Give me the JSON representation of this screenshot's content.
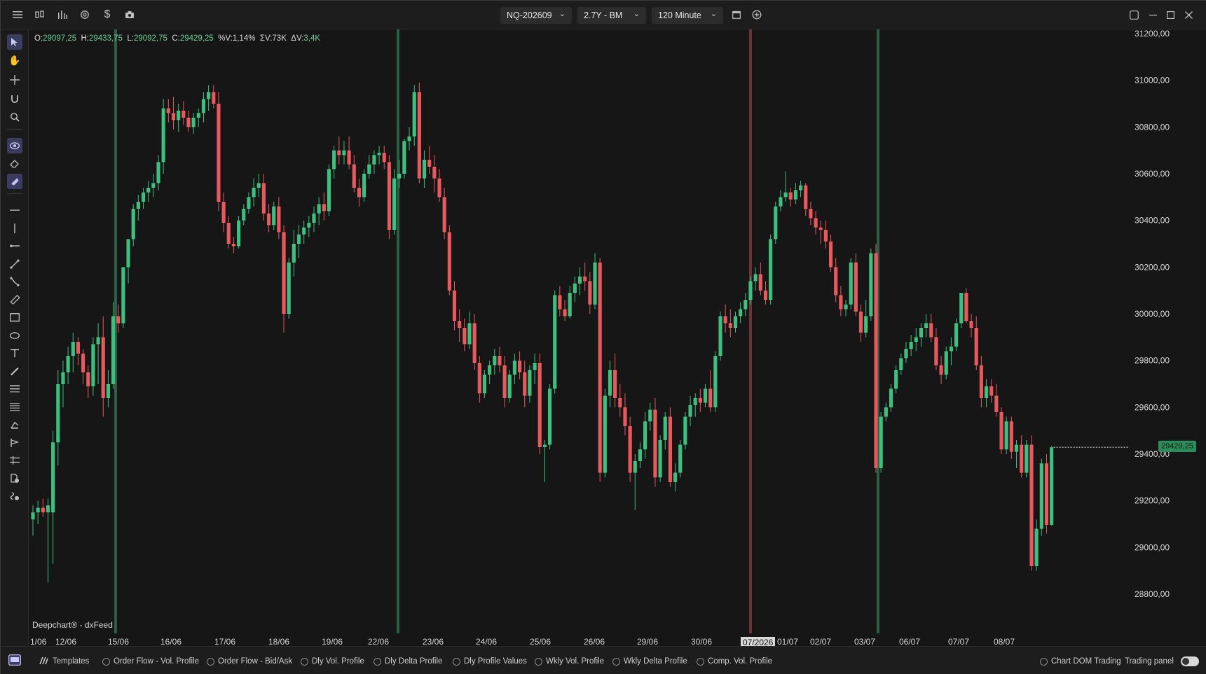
{
  "topbar": {
    "symbol": "NQ-202609",
    "range": "2.7Y - BM",
    "timeframe": "120 Minute",
    "icons": [
      "menu-icon",
      "candles-icon",
      "bars-icon",
      "settings-icon",
      "dollar-icon",
      "camera-icon",
      "calendar-icon",
      "add-icon"
    ],
    "window_icons": [
      "layout-icon",
      "minimize-icon",
      "maximize-icon",
      "close-icon"
    ]
  },
  "ohlc": {
    "o_label": "O:",
    "o": "29097,25",
    "h_label": "H:",
    "h": "29433,75",
    "l_label": "L:",
    "l": "29092,75",
    "c_label": "C:",
    "c": "29429,25",
    "pv_label": "%V:",
    "pv": "1,14%",
    "sv_label": "ΣV:",
    "sv": "73K",
    "dv_label": "ΔV:",
    "dv": "3,4K"
  },
  "credit": "Deepchart® - dxFeed",
  "last_price_label": "29429,25",
  "highlight_date": "07/2026",
  "chart_data": {
    "type": "candlestick",
    "ylim": [
      28600,
      31250
    ],
    "y_ticks": [
      "31200,00",
      "31000,00",
      "30800,00",
      "30600,00",
      "30400,00",
      "30200,00",
      "30000,00",
      "29800,00",
      "29600,00",
      "29400,00",
      "29200,00",
      "29000,00",
      "28800,00"
    ],
    "y_tick_values": [
      31200,
      31000,
      30800,
      30600,
      30400,
      30200,
      30000,
      29800,
      29600,
      29400,
      29200,
      29000,
      28800
    ],
    "x_labels": [
      "1/06",
      "12/06",
      "15/06",
      "16/06",
      "17/06",
      "18/06",
      "19/06",
      "22/06",
      "23/06",
      "24/06",
      "25/06",
      "26/06",
      "29/06",
      "30/06",
      "07/2026",
      "01/07",
      "02/07",
      "03/07",
      "06/07",
      "07/07",
      "08/07"
    ],
    "last_price": 29429.25,
    "colors": {
      "up": "#3fbf7f",
      "down": "#e8595e",
      "bg": "#161616",
      "week_line": "#2f6b4d",
      "month_line": "#7a3a3a"
    },
    "candles": [
      [
        29120,
        29180,
        29050,
        29150
      ],
      [
        29150,
        29200,
        29100,
        29170
      ],
      [
        29170,
        29210,
        29130,
        29150
      ],
      [
        29150,
        29210,
        28850,
        29180
      ],
      [
        29150,
        29500,
        28930,
        29450
      ],
      [
        29450,
        29760,
        29350,
        29700
      ],
      [
        29700,
        29800,
        29600,
        29750
      ],
      [
        29750,
        29860,
        29700,
        29820
      ],
      [
        29820,
        29920,
        29750,
        29880
      ],
      [
        29880,
        29900,
        29780,
        29830
      ],
      [
        29830,
        29850,
        29700,
        29750
      ],
      [
        29750,
        29780,
        29640,
        29690
      ],
      [
        29690,
        29900,
        29650,
        29870
      ],
      [
        29870,
        29960,
        29700,
        29900
      ],
      [
        29900,
        29990,
        29560,
        29640
      ],
      [
        29640,
        29760,
        29600,
        29700
      ],
      [
        29700,
        30050,
        29680,
        29990
      ],
      [
        29990,
        30040,
        29920,
        29960
      ],
      [
        29960,
        30120,
        29940,
        30200
      ],
      [
        30200,
        30320,
        30130,
        30320
      ],
      [
        30320,
        30470,
        30290,
        30450
      ],
      [
        30450,
        30510,
        30400,
        30480
      ],
      [
        30480,
        30540,
        30450,
        30520
      ],
      [
        30520,
        30570,
        30480,
        30540
      ],
      [
        30540,
        30600,
        30500,
        30560
      ],
      [
        30560,
        30680,
        30530,
        30650
      ],
      [
        30650,
        30920,
        30600,
        30880
      ],
      [
        30880,
        30920,
        30820,
        30860
      ],
      [
        30860,
        30930,
        30790,
        30830
      ],
      [
        30830,
        30900,
        30780,
        30870
      ],
      [
        30870,
        30910,
        30810,
        30840
      ],
      [
        30840,
        30870,
        30780,
        30800
      ],
      [
        30800,
        30860,
        30770,
        30840
      ],
      [
        30840,
        30880,
        30800,
        30860
      ],
      [
        30860,
        30950,
        30820,
        30920
      ],
      [
        30920,
        30980,
        30870,
        30950
      ],
      [
        30950,
        30980,
        30880,
        30900
      ],
      [
        30900,
        30950,
        30440,
        30480
      ],
      [
        30480,
        30520,
        30350,
        30390
      ],
      [
        30390,
        30420,
        30280,
        30300
      ],
      [
        30300,
        30330,
        30260,
        30290
      ],
      [
        30290,
        30420,
        30280,
        30400
      ],
      [
        30400,
        30470,
        30380,
        30450
      ],
      [
        30450,
        30520,
        30430,
        30500
      ],
      [
        30500,
        30580,
        30460,
        30540
      ],
      [
        30540,
        30600,
        30500,
        30560
      ],
      [
        30560,
        30600,
        30400,
        30430
      ],
      [
        30430,
        30470,
        30350,
        30380
      ],
      [
        30380,
        30480,
        30360,
        30460
      ],
      [
        30460,
        30500,
        30320,
        30350
      ],
      [
        30350,
        30380,
        29920,
        30000
      ],
      [
        30000,
        30240,
        29980,
        30220
      ],
      [
        30220,
        30360,
        30160,
        30300
      ],
      [
        30300,
        30380,
        30240,
        30340
      ],
      [
        30340,
        30400,
        30300,
        30370
      ],
      [
        30370,
        30420,
        30330,
        30390
      ],
      [
        30390,
        30460,
        30350,
        30430
      ],
      [
        30430,
        30500,
        30380,
        30470
      ],
      [
        30470,
        30520,
        30400,
        30440
      ],
      [
        30440,
        30640,
        30420,
        30620
      ],
      [
        30620,
        30720,
        30580,
        30700
      ],
      [
        30700,
        30760,
        30640,
        30680
      ],
      [
        30680,
        30740,
        30640,
        30700
      ],
      [
        30700,
        30760,
        30620,
        30640
      ],
      [
        30640,
        30680,
        30520,
        30540
      ],
      [
        30540,
        30580,
        30460,
        30500
      ],
      [
        30500,
        30620,
        30480,
        30600
      ],
      [
        30600,
        30680,
        30580,
        30640
      ],
      [
        30640,
        30700,
        30600,
        30680
      ],
      [
        30680,
        30720,
        30640,
        30690
      ],
      [
        30690,
        30720,
        30620,
        30650
      ],
      [
        30650,
        30680,
        30320,
        30360
      ],
      [
        30360,
        30620,
        30340,
        30580
      ],
      [
        30580,
        30660,
        30540,
        30600
      ],
      [
        30600,
        30750,
        30580,
        30740
      ],
      [
        30740,
        30800,
        30700,
        30760
      ],
      [
        30760,
        30980,
        30720,
        30950
      ],
      [
        30950,
        30990,
        30560,
        30580
      ],
      [
        30580,
        30700,
        30540,
        30660
      ],
      [
        30660,
        30720,
        30600,
        30630
      ],
      [
        30630,
        30680,
        30520,
        30580
      ],
      [
        30580,
        30620,
        30480,
        30500
      ],
      [
        30500,
        30540,
        30320,
        30350
      ],
      [
        30350,
        30380,
        30080,
        30100
      ],
      [
        30100,
        30140,
        29930,
        29970
      ],
      [
        29970,
        30020,
        29880,
        29940
      ],
      [
        29940,
        29980,
        29840,
        29870
      ],
      [
        29870,
        30010,
        29850,
        29960
      ],
      [
        29960,
        30000,
        29760,
        29790
      ],
      [
        29790,
        29820,
        29620,
        29660
      ],
      [
        29660,
        29760,
        29640,
        29740
      ],
      [
        29740,
        29800,
        29700,
        29780
      ],
      [
        29780,
        29850,
        29740,
        29820
      ],
      [
        29820,
        29860,
        29750,
        29780
      ],
      [
        29780,
        29820,
        29600,
        29640
      ],
      [
        29640,
        29760,
        29620,
        29740
      ],
      [
        29740,
        29830,
        29700,
        29800
      ],
      [
        29800,
        29840,
        29720,
        29750
      ],
      [
        29750,
        29800,
        29600,
        29650
      ],
      [
        29650,
        29780,
        29620,
        29760
      ],
      [
        29760,
        29830,
        29700,
        29790
      ],
      [
        29790,
        29830,
        29400,
        29430
      ],
      [
        29430,
        29460,
        29280,
        29440
      ],
      [
        29440,
        29700,
        29420,
        29680
      ],
      [
        29680,
        30100,
        29660,
        30080
      ],
      [
        30080,
        30120,
        29990,
        30020
      ],
      [
        30020,
        30060,
        29970,
        29990
      ],
      [
        29990,
        30120,
        29980,
        30090
      ],
      [
        30090,
        30160,
        30050,
        30130
      ],
      [
        30130,
        30200,
        30080,
        30160
      ],
      [
        30160,
        30220,
        30100,
        30140
      ],
      [
        30140,
        30180,
        30000,
        30040
      ],
      [
        30040,
        30260,
        30020,
        30220
      ],
      [
        30220,
        30240,
        29280,
        29320
      ],
      [
        29320,
        29680,
        29300,
        29650
      ],
      [
        29650,
        29800,
        29600,
        29760
      ],
      [
        29760,
        29830,
        29600,
        29640
      ],
      [
        29640,
        29700,
        29560,
        29600
      ],
      [
        29600,
        29660,
        29480,
        29520
      ],
      [
        29520,
        29560,
        29280,
        29320
      ],
      [
        29320,
        29400,
        29160,
        29370
      ],
      [
        29370,
        29450,
        29340,
        29420
      ],
      [
        29420,
        29580,
        29380,
        29540
      ],
      [
        29540,
        29620,
        29500,
        29590
      ],
      [
        29590,
        29640,
        29260,
        29300
      ],
      [
        29300,
        29480,
        29280,
        29460
      ],
      [
        29460,
        29580,
        29420,
        29560
      ],
      [
        29560,
        29600,
        29260,
        29280
      ],
      [
        29280,
        29360,
        29240,
        29320
      ],
      [
        29320,
        29460,
        29300,
        29440
      ],
      [
        29440,
        29580,
        29420,
        29560
      ],
      [
        29560,
        29650,
        29520,
        29610
      ],
      [
        29610,
        29660,
        29560,
        29640
      ],
      [
        29640,
        29680,
        29580,
        29620
      ],
      [
        29620,
        29700,
        29600,
        29680
      ],
      [
        29680,
        29760,
        29580,
        29600
      ],
      [
        29600,
        29840,
        29580,
        29820
      ],
      [
        29820,
        30010,
        29800,
        29990
      ],
      [
        29990,
        30040,
        29920,
        29960
      ],
      [
        29960,
        30020,
        29900,
        29940
      ],
      [
        29940,
        30010,
        29920,
        29990
      ],
      [
        29990,
        30050,
        29960,
        30020
      ],
      [
        30020,
        30090,
        29990,
        30060
      ],
      [
        30060,
        30160,
        30040,
        30140
      ],
      [
        30140,
        30200,
        30100,
        30170
      ],
      [
        30170,
        30220,
        30080,
        30100
      ],
      [
        30100,
        30140,
        30040,
        30060
      ],
      [
        30060,
        30340,
        30040,
        30320
      ],
      [
        30320,
        30480,
        30300,
        30460
      ],
      [
        30460,
        30530,
        30440,
        30500
      ],
      [
        30500,
        30610,
        30480,
        30520
      ],
      [
        30520,
        30540,
        30460,
        30490
      ],
      [
        30490,
        30560,
        30470,
        30530
      ],
      [
        30530,
        30570,
        30500,
        30550
      ],
      [
        30550,
        30560,
        30420,
        30450
      ],
      [
        30450,
        30480,
        30380,
        30410
      ],
      [
        30410,
        30440,
        30340,
        30370
      ],
      [
        30370,
        30400,
        30300,
        30360
      ],
      [
        30360,
        30400,
        30280,
        30310
      ],
      [
        30310,
        30340,
        30180,
        30200
      ],
      [
        30200,
        30240,
        30050,
        30080
      ],
      [
        30080,
        30120,
        29990,
        30020
      ],
      [
        30020,
        30060,
        29990,
        30040
      ],
      [
        30040,
        30240,
        30020,
        30220
      ],
      [
        30220,
        30260,
        29990,
        30010
      ],
      [
        30010,
        30040,
        29880,
        29920
      ],
      [
        29920,
        30060,
        29900,
        29990
      ],
      [
        29990,
        30280,
        29970,
        30260
      ],
      [
        30260,
        30300,
        29320,
        29340
      ],
      [
        29340,
        29580,
        29320,
        29560
      ],
      [
        29560,
        29620,
        29540,
        29600
      ],
      [
        29600,
        29700,
        29580,
        29680
      ],
      [
        29680,
        29780,
        29660,
        29760
      ],
      [
        29760,
        29830,
        29740,
        29810
      ],
      [
        29810,
        29880,
        29790,
        29850
      ],
      [
        29850,
        29910,
        29820,
        29880
      ],
      [
        29880,
        29940,
        29840,
        29900
      ],
      [
        29900,
        29960,
        29860,
        29940
      ],
      [
        29940,
        30000,
        29900,
        29960
      ],
      [
        29960,
        30000,
        29880,
        29900
      ],
      [
        29900,
        29940,
        29760,
        29780
      ],
      [
        29780,
        29820,
        29700,
        29740
      ],
      [
        29740,
        29860,
        29720,
        29840
      ],
      [
        29840,
        29900,
        29780,
        29860
      ],
      [
        29860,
        29980,
        29840,
        29960
      ],
      [
        29960,
        30060,
        29940,
        30090
      ],
      [
        30090,
        30110,
        29960,
        29970
      ],
      [
        29970,
        30000,
        29900,
        29940
      ],
      [
        29940,
        29990,
        29760,
        29780
      ],
      [
        29780,
        29820,
        29600,
        29640
      ],
      [
        29640,
        29720,
        29600,
        29690
      ],
      [
        29690,
        29720,
        29620,
        29650
      ],
      [
        29650,
        29700,
        29560,
        29580
      ],
      [
        29580,
        29600,
        29400,
        29420
      ],
      [
        29420,
        29560,
        29400,
        29540
      ],
      [
        29540,
        29560,
        29380,
        29410
      ],
      [
        29410,
        29460,
        29340,
        29440
      ],
      [
        29440,
        29480,
        29300,
        29320
      ],
      [
        29320,
        29460,
        29300,
        29440
      ],
      [
        29440,
        29480,
        28900,
        28920
      ],
      [
        28920,
        29120,
        28900,
        29080
      ],
      [
        29080,
        29380,
        29050,
        29360
      ],
      [
        29360,
        29400,
        29060,
        29097
      ],
      [
        29097,
        29434,
        29093,
        29429
      ]
    ]
  },
  "bottombar": {
    "templates_label": "Templates",
    "items": [
      "Order Flow - Vol. Profile",
      "Order Flow - Bid/Ask",
      "Dly Vol. Profile",
      "Dly Delta Profile",
      "Dly Profile Values",
      "Wkly Vol. Profile",
      "Wkly Delta Profile",
      "Comp. Vol. Profile"
    ],
    "chart_dom_label": "Chart DOM Trading",
    "trading_panel_label": "Trading panel"
  }
}
